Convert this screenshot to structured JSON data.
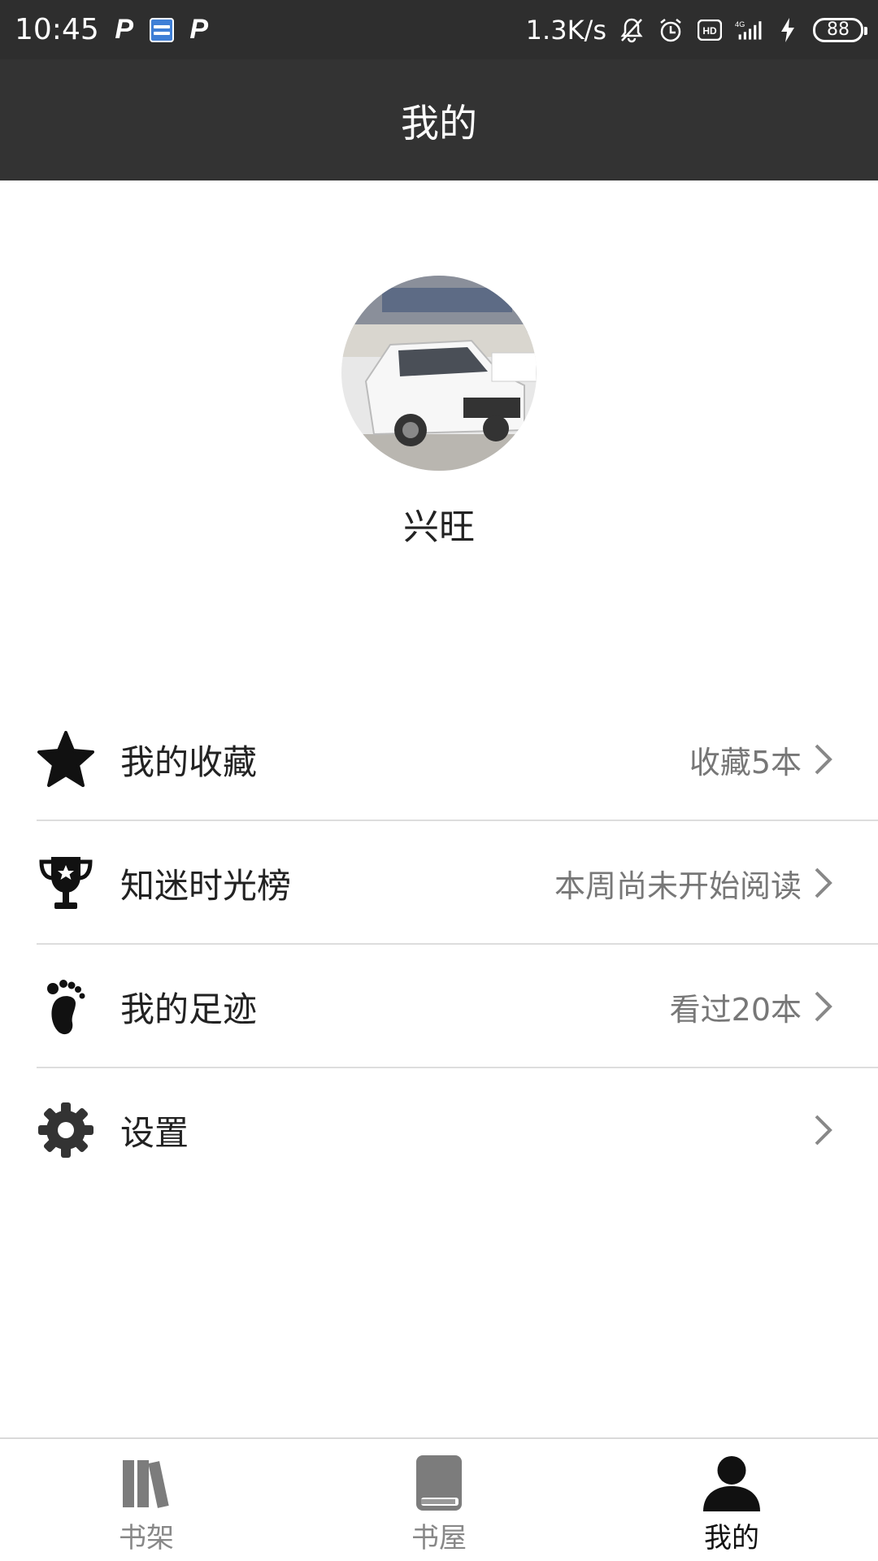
{
  "status_bar": {
    "time": "10:45",
    "speed": "1.3K/s",
    "battery": "88",
    "icons": [
      "p-app-icon",
      "car-app-icon",
      "p-app-icon",
      "mute-bell-icon",
      "alarm-icon",
      "hd-icon",
      "4g-signal-icon",
      "charging-icon",
      "battery-icon"
    ]
  },
  "header": {
    "title": "我的"
  },
  "profile": {
    "username": "兴旺",
    "avatar": "avatar-image"
  },
  "menu": [
    {
      "label": "我的收藏",
      "value": "收藏5本",
      "icon": "star-icon"
    },
    {
      "label": "知迷时光榜",
      "value": "本周尚未开始阅读",
      "icon": "trophy-icon"
    },
    {
      "label": "我的足迹",
      "value": "看过20本",
      "icon": "footprint-icon"
    },
    {
      "label": "设置",
      "value": "",
      "icon": "gear-icon"
    }
  ],
  "tabs": [
    {
      "label": "书架",
      "icon": "bookshelf-icon",
      "active": false
    },
    {
      "label": "书屋",
      "icon": "book-icon",
      "active": false
    },
    {
      "label": "我的",
      "icon": "user-icon",
      "active": true
    }
  ],
  "colors": {
    "header_bg": "#333333",
    "text": "#222222",
    "muted": "#777777",
    "tab_inactive": "#888888"
  }
}
